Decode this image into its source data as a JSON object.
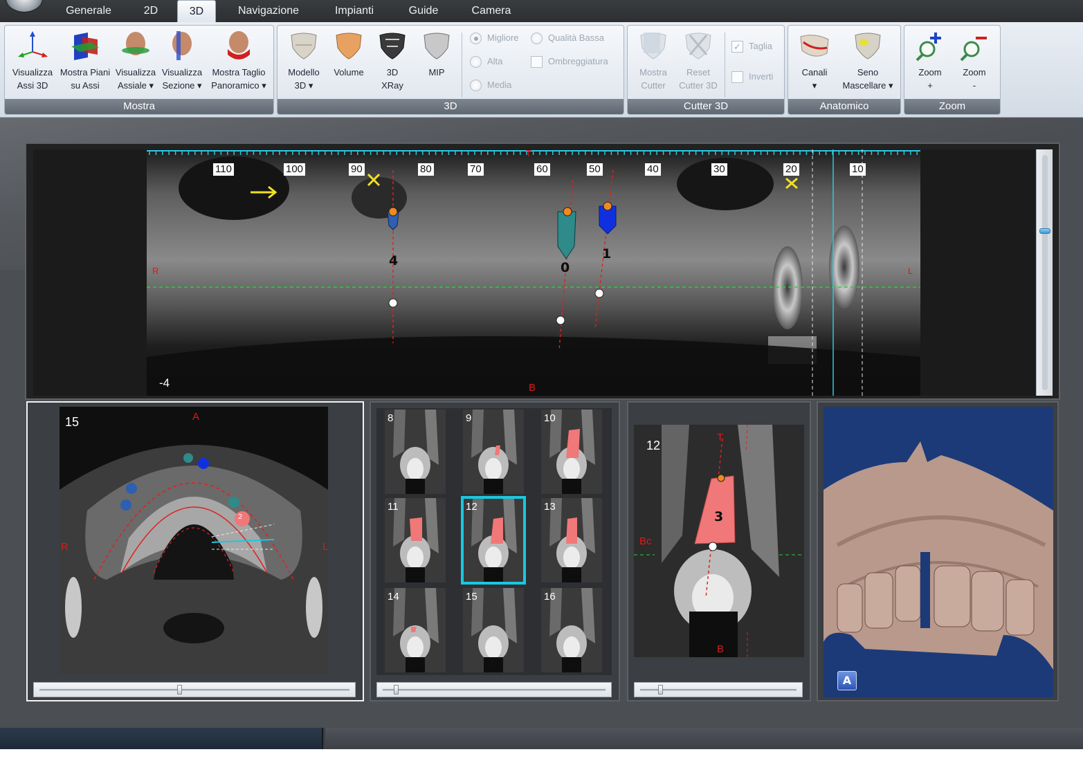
{
  "tabs": [
    {
      "label": "Generale"
    },
    {
      "label": "2D"
    },
    {
      "label": "3D",
      "active": true
    },
    {
      "label": "Navigazione"
    },
    {
      "label": "Impianti"
    },
    {
      "label": "Guide"
    },
    {
      "label": "Camera"
    }
  ],
  "ribbon": {
    "mostra": {
      "label": "Mostra",
      "buttons": [
        {
          "label": "Visualizza\nAssi 3D",
          "icon": "axes-icon"
        },
        {
          "label": "Mostra Piani\nsu Assi",
          "icon": "planes-icon"
        },
        {
          "label": "Visualizza\nAssiale ▾",
          "icon": "head-axial-icon"
        },
        {
          "label": "Visualizza\nSezione ▾",
          "icon": "head-section-icon"
        },
        {
          "label": "Mostra Taglio\nPanoramico ▾",
          "icon": "head-panoramic-icon"
        }
      ]
    },
    "view3d": {
      "label": "3D",
      "buttons": [
        {
          "label": "Modello\n3D ▾",
          "icon": "model-3d-icon"
        },
        {
          "label": "Volume",
          "icon": "volume-icon"
        },
        {
          "label": "3D\nXRay",
          "icon": "xray-icon"
        },
        {
          "label": "MIP",
          "icon": "mip-icon"
        }
      ],
      "quality": {
        "migliore": "Migliore",
        "alta": "Alta",
        "media": "Media",
        "qualita_bassa": "Qualità Bassa",
        "ombreggiatura": "Ombreggiatura"
      }
    },
    "cutter": {
      "label": "Cutter 3D",
      "mostra_cutter": "Mostra\nCutter",
      "reset_cutter": "Reset\nCutter 3D",
      "taglia": "Taglia",
      "inverti": "Inverti"
    },
    "anatomico": {
      "label": "Anatomico",
      "canali": "Canali\n▾",
      "seno": "Seno\nMascellare ▾"
    },
    "zoom": {
      "label": "Zoom",
      "zoom_in": "Zoom\n+",
      "zoom_out": "Zoom\n-"
    }
  },
  "panoramic": {
    "ruler_labels": [
      "110",
      "100",
      "90",
      "80",
      "70",
      "60",
      "50",
      "40",
      "30",
      "20",
      "10"
    ],
    "slice_value": "-4",
    "top_marker": "T",
    "bottom_marker": "B",
    "left_marker": "R",
    "right_marker": "L",
    "implants": [
      {
        "label": "4",
        "color": "#2e5fb0"
      },
      {
        "label": "0",
        "color": "#2f8a8a"
      },
      {
        "label": "1",
        "color": "#1030e0"
      }
    ],
    "slider_level": 0.68
  },
  "axial": {
    "slice_number": "15",
    "marker_a": "A",
    "marker_r": "R",
    "marker_l": "L",
    "implant_label": "2",
    "slider_level": 0.45
  },
  "cross_sections": {
    "thumbs": [
      "8",
      "9",
      "10",
      "11",
      "12",
      "13",
      "14",
      "15",
      "16"
    ],
    "selected": "12",
    "slider_level": 0.05
  },
  "section_view": {
    "slice_number": "12",
    "marker_t": "T",
    "marker_b": "B",
    "marker_bc": "Bc",
    "implant_label": "3",
    "slider_level": 0.12
  },
  "model3d": {
    "orientation_label": "A"
  },
  "colors": {
    "implant_pink": "#f07878",
    "selection_cyan": "#19c8e0",
    "model_background": "#1c3a78",
    "bone_tan": "#b8998c"
  }
}
